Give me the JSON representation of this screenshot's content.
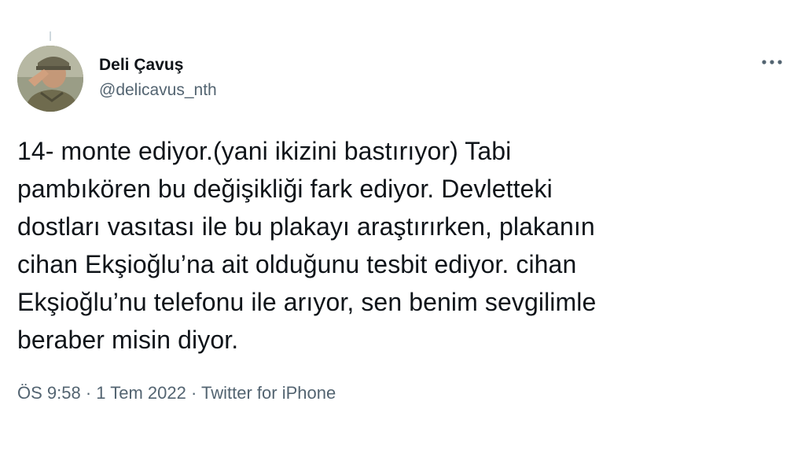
{
  "tweet": {
    "author": {
      "display_name": "Deli Çavuş",
      "handle": "@delicavus_nth"
    },
    "text_lines": [
      "14- monte ediyor.(yani ikizini bastırıyor) Tabi",
      "pambıkören bu değişikliği fark ediyor. Devletteki",
      "dostları vasıtası ile bu plakayı araştırırken, plakanın",
      "cihan Ekşioğlu’na ait olduğunu tesbit ediyor. cihan",
      "Ekşioğlu’nu telefonu ile arıyor, sen benim sevgilimle",
      "beraber misin diyor."
    ],
    "meta": {
      "time": "ÖS 9:58",
      "separator": " · ",
      "date": "1 Tem 2022",
      "source": "Twitter for iPhone"
    },
    "icons": {
      "more": "more-horizontal-icon",
      "avatar": "avatar-image"
    }
  },
  "colors": {
    "text_primary": "#0f1419",
    "text_secondary": "#536471",
    "background": "#ffffff"
  }
}
